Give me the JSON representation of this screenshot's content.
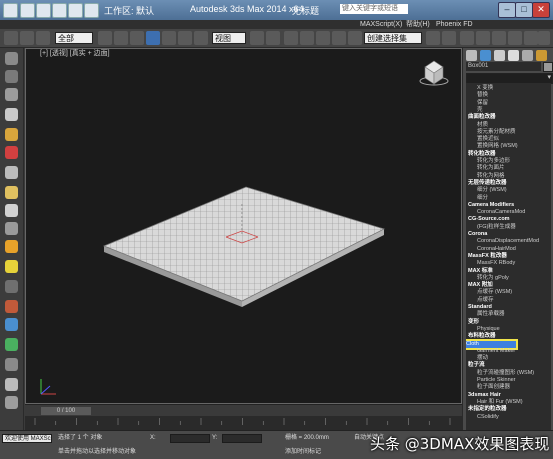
{
  "titlebar": {
    "workspace": "工作区: 默认",
    "app_title": "Autodesk 3ds Max  2014 x64",
    "doc_title": "无标题",
    "search_placeholder": "键入关键字或短语",
    "menus": [
      "MAXScript(X)",
      "帮助(H)",
      "Phoenix FD"
    ],
    "window_buttons": [
      "–",
      "□",
      "✕"
    ]
  },
  "toolbar": {
    "select_filter": "全部",
    "ref_coord": "视图",
    "named_selection": "创建选择集"
  },
  "viewport": {
    "label": "[+] [透视] [真实 + 边面]"
  },
  "command_panel": {
    "object_name": "Box001",
    "modifier_items": [
      {
        "text": "X 变换",
        "kind": "s"
      },
      {
        "text": "替换",
        "kind": "s"
      },
      {
        "text": "保留",
        "kind": "s"
      },
      {
        "text": "壳",
        "kind": "s"
      },
      {
        "text": "曲面粒改器",
        "kind": "h"
      },
      {
        "text": "材质",
        "kind": "s"
      },
      {
        "text": "按元素分配材质",
        "kind": "s"
      },
      {
        "text": "置换近似",
        "kind": "s"
      },
      {
        "text": "置换网格 (WSM)",
        "kind": "s"
      },
      {
        "text": "转化粒改器",
        "kind": "h"
      },
      {
        "text": "转化为多边形",
        "kind": "s"
      },
      {
        "text": "转化为面片",
        "kind": "s"
      },
      {
        "text": "转化为网格",
        "kind": "s"
      },
      {
        "text": "无层传递粒改器",
        "kind": "h"
      },
      {
        "text": "细分 (WSM)",
        "kind": "s"
      },
      {
        "text": "细分",
        "kind": "s"
      },
      {
        "text": "Camera Modifiers",
        "kind": "h"
      },
      {
        "text": "CoronaCameraMod",
        "kind": "s"
      },
      {
        "text": "CG-Source.com",
        "kind": "h"
      },
      {
        "text": "(FG)粒样生成器",
        "kind": "s"
      },
      {
        "text": "Corona",
        "kind": "h"
      },
      {
        "text": "CoronaDisplacementMod",
        "kind": "s"
      },
      {
        "text": "CoronaHairMod",
        "kind": "s"
      },
      {
        "text": "MassFX 粒改器",
        "kind": "h"
      },
      {
        "text": "MassFX RBody",
        "kind": "s"
      },
      {
        "text": "MAX 标准",
        "kind": "h"
      },
      {
        "text": "转化为 gPoly",
        "kind": "s"
      },
      {
        "text": "MAX 附加",
        "kind": "h"
      },
      {
        "text": "点缓存 (WSM)",
        "kind": "s"
      },
      {
        "text": "点缓存",
        "kind": "s"
      },
      {
        "text": "Standard",
        "kind": "h"
      },
      {
        "text": "属性承载器",
        "kind": "s"
      },
      {
        "text": "变形",
        "kind": "h"
      },
      {
        "text": "Physique",
        "kind": "s"
      },
      {
        "text": "布料粒改器",
        "kind": "h"
      },
      {
        "text": "Cloth",
        "kind": "sel"
      },
      {
        "text": "Garment Maker",
        "kind": "s"
      },
      {
        "text": "摆动",
        "kind": "s"
      },
      {
        "text": "粒子流",
        "kind": "h"
      },
      {
        "text": "粒子流碰撞图形 (WSM)",
        "kind": "s"
      },
      {
        "text": "Particle Skinner",
        "kind": "s"
      },
      {
        "text": "粒子面创建器",
        "kind": "s"
      },
      {
        "text": "3dsmax Hair",
        "kind": "h"
      },
      {
        "text": "Hair 和 Fur (WSM)",
        "kind": "s"
      },
      {
        "text": "未指定的粒改器",
        "kind": "h"
      },
      {
        "text": "CSolidify",
        "kind": "s"
      }
    ]
  },
  "timeslider": {
    "position": "0 / 100"
  },
  "statusbar": {
    "welcome": "欢迎使用 MAXSc",
    "selected": "选择了 1 个 对象",
    "hint": "单击并拖动以选择并移动对象",
    "x_label": "X:",
    "y_label": "Y:",
    "grid": "栅格 = 200.0mm",
    "autokey": "自动关键点",
    "add_time_tag": "添加时间标记",
    "watermark": "头条 @3DMAX效果图表现"
  },
  "colors": {
    "selection_highlight": "#f0e44b",
    "title_bar": "#5a7da3",
    "close_button": "#c8413a"
  }
}
